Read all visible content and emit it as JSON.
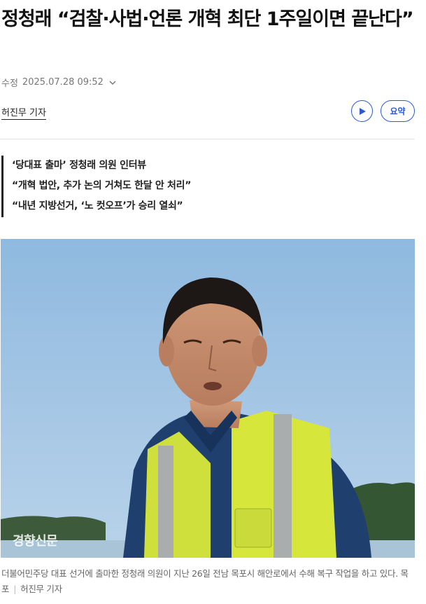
{
  "article": {
    "title": "정청래 “검찰·사법·언론 개혁 최단 1주일이면 끝난다”",
    "modified_label": "수정",
    "modified_time": "2025.07.28 09:52",
    "byline": "허진무 기자",
    "play_icon": "play-icon",
    "summary_label": "요약",
    "subheads": [
      "‘당대표 출마’ 정청래 의원 인터뷰",
      "“개혁 법안, 추가 논의 거쳐도 한달 안 처리”",
      "“내년 지방선거, ‘노 컷오프’가 승리 열쇠”"
    ],
    "photo": {
      "watermark": "경향신문",
      "caption": "더불어민주당 대표 선거에 출마한 정청래 의원이 지난 26일 전남 목포시 해안로에서 수해 복구 작업을 하고 있다. 목포",
      "credit": "허진무 기자"
    }
  },
  "colors": {
    "accent": "#2b5ad1",
    "sky": "#9ec3e4",
    "vest": "#d7e63a"
  }
}
